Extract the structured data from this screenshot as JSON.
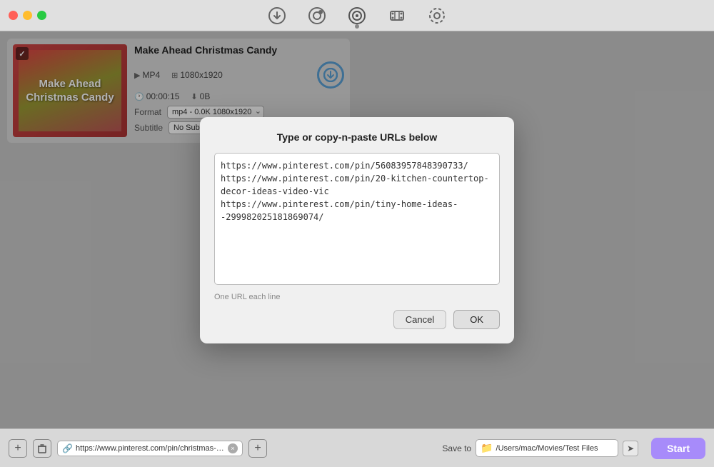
{
  "titlebar": {
    "buttons": {
      "close": "×",
      "minimize": "–",
      "maximize": "+"
    },
    "icons": [
      {
        "name": "download-circle-icon",
        "symbol": "⊙",
        "active": false
      },
      {
        "name": "record-icon",
        "symbol": "◎",
        "active": false
      },
      {
        "name": "video-convert-icon",
        "symbol": "⊛",
        "active": true
      },
      {
        "name": "film-icon",
        "symbol": "◈",
        "active": false
      },
      {
        "name": "settings-icon",
        "symbol": "◉",
        "active": false
      }
    ]
  },
  "video_card": {
    "thumbnail_text": "Make Ahead Christmas Candy",
    "title": "Make Ahead Christmas Candy",
    "format_badge": "MP4",
    "resolution": "1080x1920",
    "duration": "00:00:15",
    "filesize": "0B",
    "format_value": "mp4 - 0.0K 1080x1920",
    "format_label": "Format",
    "subtitle_label": "Subtitle",
    "subtitle_value": "No Subtitle"
  },
  "modal": {
    "title": "Type or copy-n-paste URLs below",
    "textarea_content": "https://www.pinterest.com/pin/56083957848390733/\nhttps://www.pinterest.com/pin/20-kitchen-countertop-decor-ideas-video-vic\nhttps://www.pinterest.com/pin/tiny-home-ideas--299982025181869074/",
    "hint": "One URL each line",
    "cancel_label": "Cancel",
    "ok_label": "OK"
  },
  "bottombar": {
    "url_text": "https://www.pinterest.com/pin/christmas-can",
    "save_to_label": "Save to",
    "save_path": "/Users/mac/Movies/Test Files",
    "start_label": "Start"
  }
}
